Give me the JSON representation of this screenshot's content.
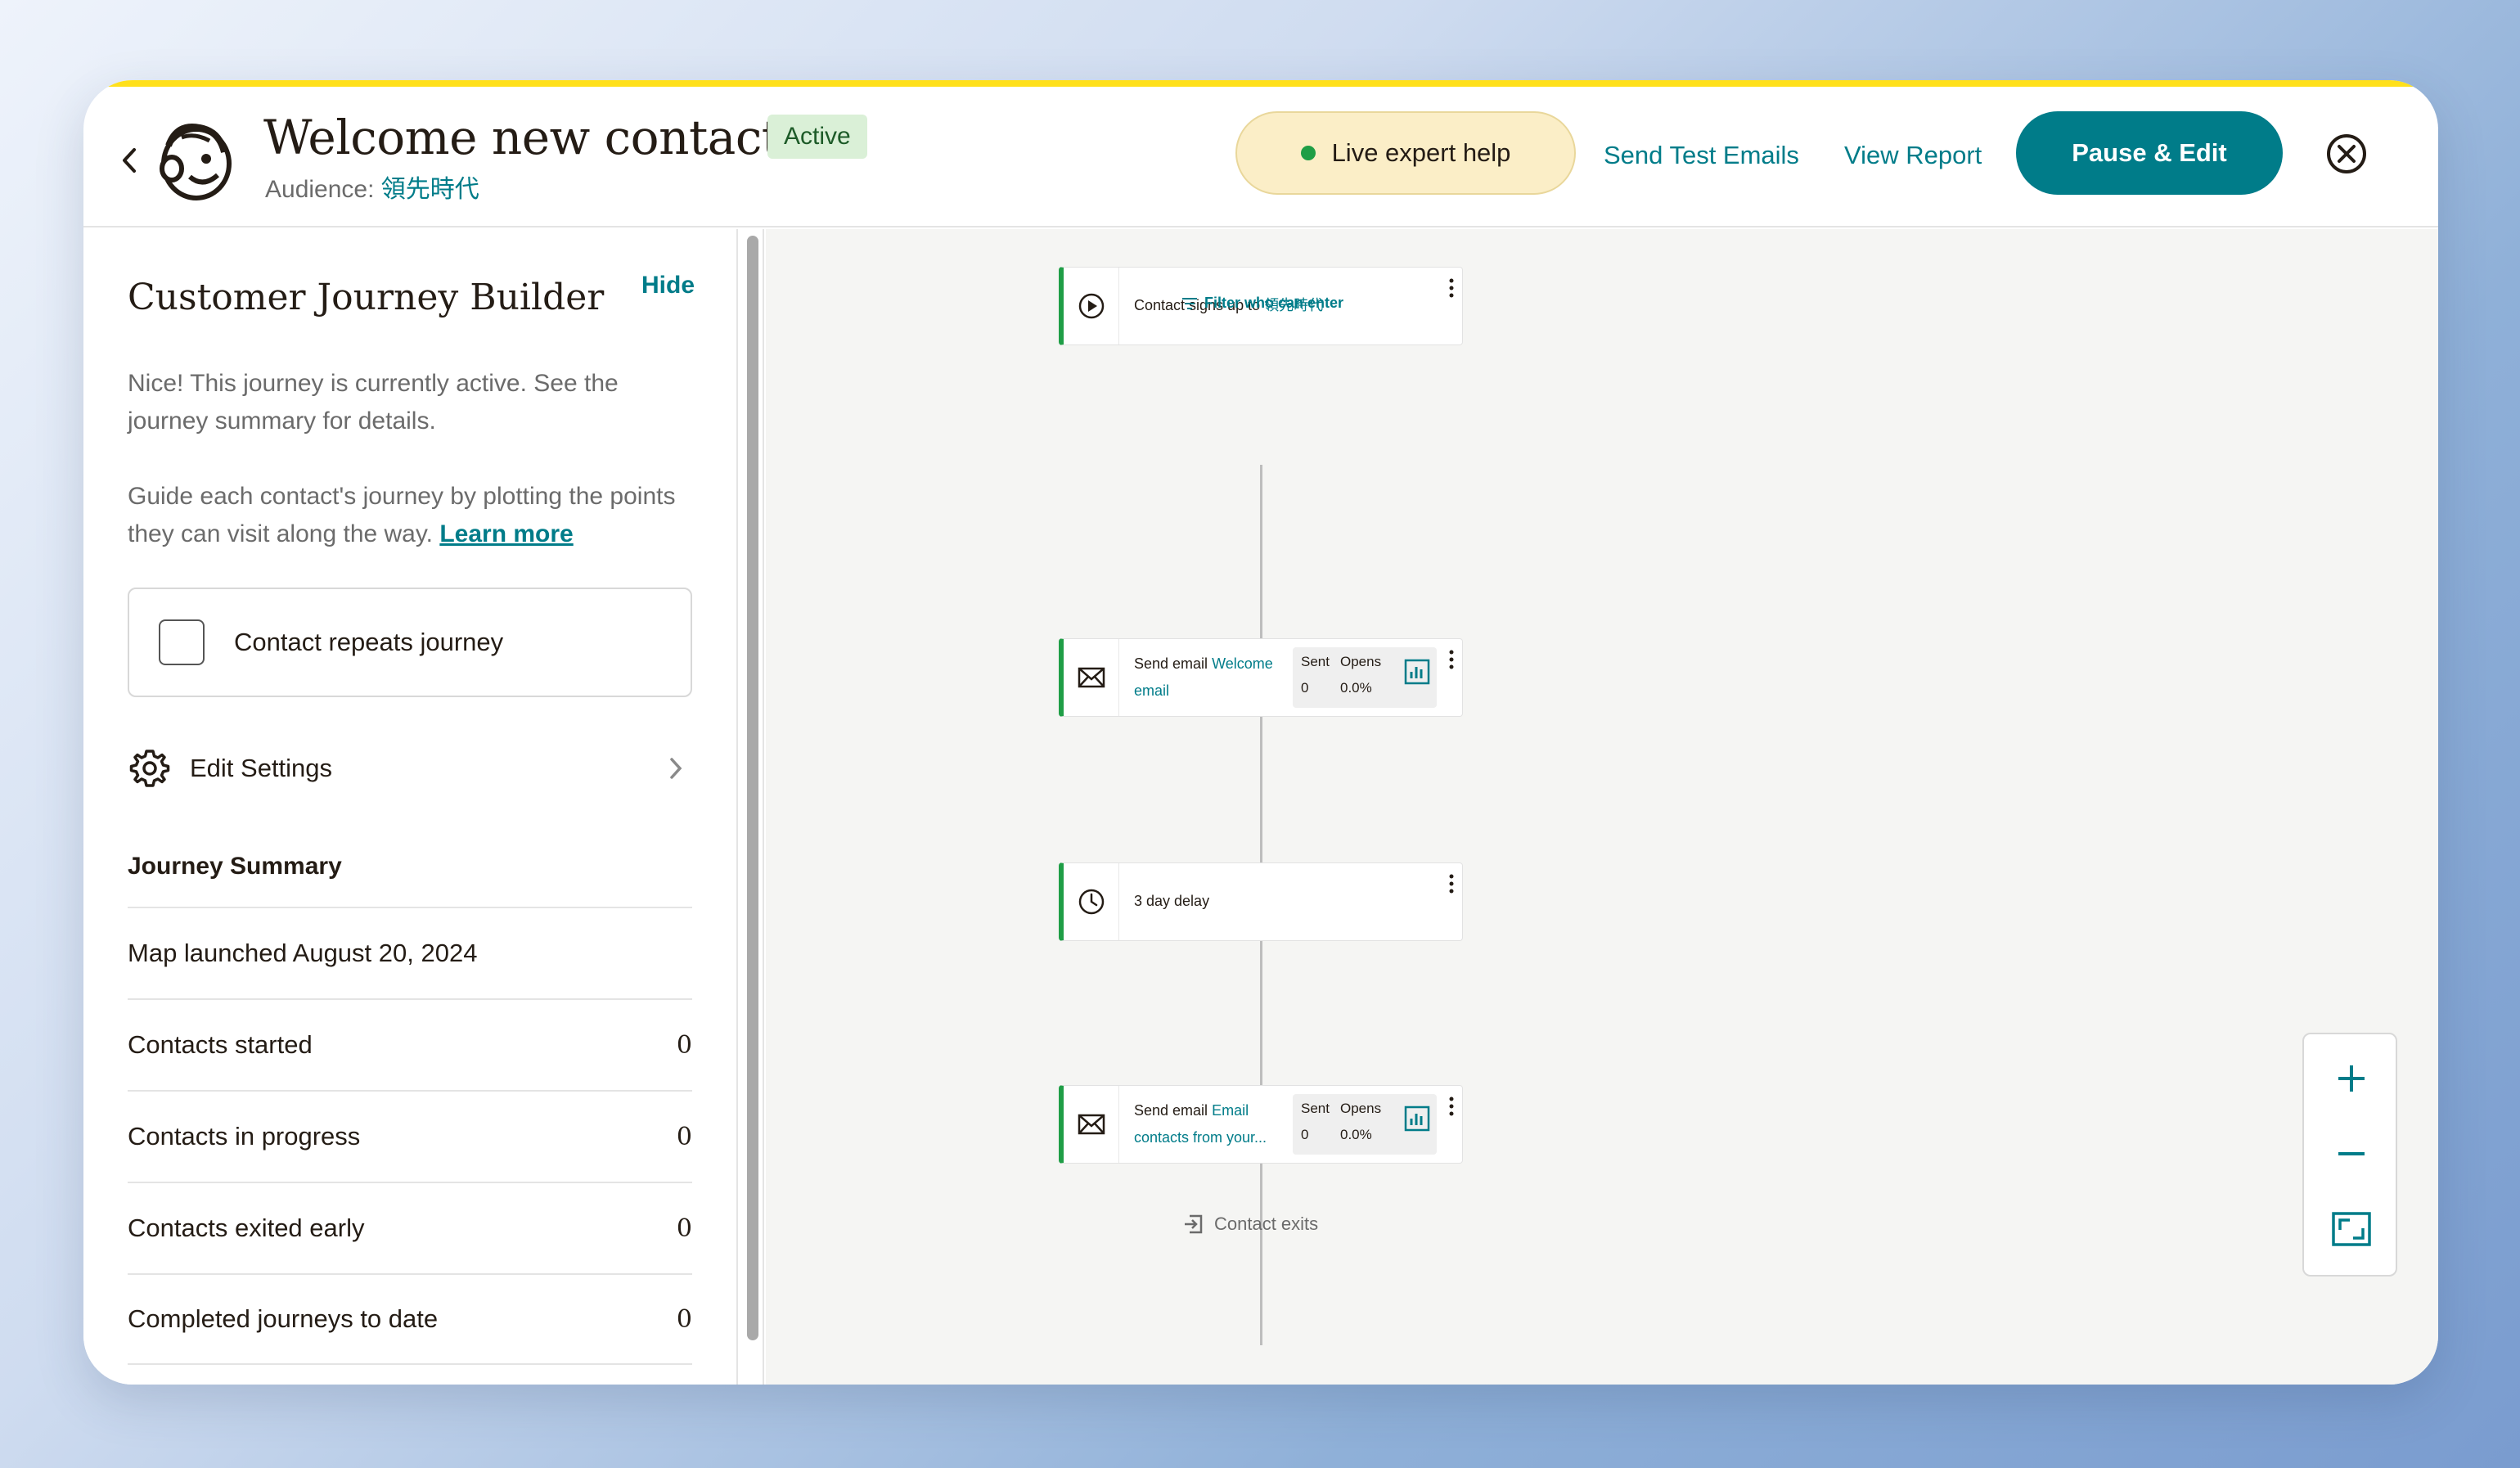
{
  "header": {
    "title": "Welcome new contacts",
    "status": "Active",
    "audience_label": "Audience:",
    "audience_value": "領先時代",
    "live_help": "Live expert help",
    "send_test": "Send Test Emails",
    "view_report": "View Report",
    "pause_edit": "Pause & Edit"
  },
  "sidebar": {
    "title": "Customer Journey Builder",
    "hide": "Hide",
    "para1": "Nice! This journey is currently active. See the journey summary for details.",
    "para2": "Guide each contact's journey by plotting the points they can visit along the way.",
    "learn_more": "Learn more",
    "repeat_label": "Contact repeats journey",
    "edit_settings": "Edit Settings",
    "summary_title": "Journey Summary",
    "launched": "Map launched August 20, 2024",
    "rows": [
      {
        "label": "Contacts started",
        "value": "0"
      },
      {
        "label": "Contacts in progress",
        "value": "0"
      },
      {
        "label": "Contacts exited early",
        "value": "0"
      },
      {
        "label": "Completed journeys to date",
        "value": "0"
      }
    ]
  },
  "canvas": {
    "trigger_prefix": "Contact signs up to",
    "trigger_link": "領先時代",
    "filter": "Filter who can enter",
    "email1_prefix": "Send email",
    "email1_link_a": "Welcome",
    "email1_link_b": "email",
    "email1_sent_label": "Sent",
    "email1_opens_label": "Opens",
    "email1_sent": "0",
    "email1_opens": "0.0%",
    "delay": "3 day delay",
    "email2_prefix": "Send email",
    "email2_link_a": "Email",
    "email2_link_b": "contacts from your...",
    "email2_sent_label": "Sent",
    "email2_opens_label": "Opens",
    "email2_sent": "0",
    "email2_opens": "0.0%",
    "exit": "Contact exits"
  },
  "colors": {
    "accent": "#007c89",
    "active_badge_bg": "#daf0d7",
    "node_border": "#1f9e46",
    "live_help_bg": "#fbeec7",
    "brand_yellow": "#ffe01b"
  },
  "icons": [
    "back-chevron-icon",
    "mailchimp-logo-icon",
    "close-circle-icon",
    "gear-icon",
    "chevron-right-icon",
    "play-icon",
    "envelope-icon",
    "clock-icon",
    "bar-chart-icon",
    "filter-icon",
    "exit-icon",
    "plus-icon",
    "minus-icon",
    "fit-screen-icon"
  ]
}
